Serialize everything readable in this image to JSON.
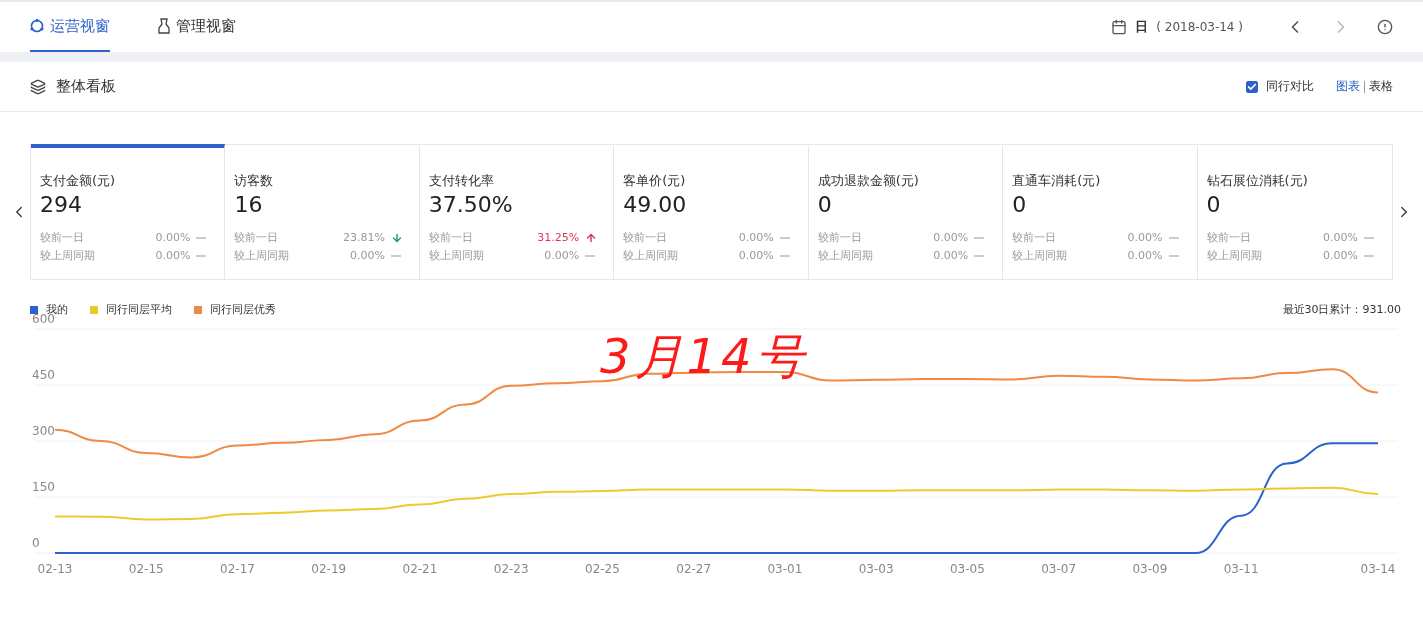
{
  "tabs": [
    {
      "label": "运营视窗",
      "selected": true
    },
    {
      "label": "管理视窗",
      "selected": false
    }
  ],
  "date": {
    "label": "日",
    "value": "( 2018-03-14 )"
  },
  "panel": {
    "title": "整体看板",
    "compare": {
      "label": "同行对比",
      "checked": true
    },
    "views": [
      {
        "label": "图表",
        "selected": true
      },
      {
        "label": "表格",
        "selected": false
      }
    ]
  },
  "metrics": [
    {
      "title": "支付金额(元)",
      "value": "294",
      "selected": true,
      "comparisons": [
        {
          "label": "较前一日",
          "value": "0.00%",
          "kind": "flat"
        },
        {
          "label": "较上周同期",
          "value": "0.00%",
          "kind": "flat"
        }
      ]
    },
    {
      "title": "访客数",
      "value": "16",
      "selected": false,
      "comparisons": [
        {
          "label": "较前一日",
          "value": "23.81%",
          "kind": "down"
        },
        {
          "label": "较上周同期",
          "value": "0.00%",
          "kind": "flat"
        }
      ]
    },
    {
      "title": "支付转化率",
      "value": "37.50%",
      "selected": false,
      "comparisons": [
        {
          "label": "较前一日",
          "value": "31.25%",
          "kind": "up"
        },
        {
          "label": "较上周同期",
          "value": "0.00%",
          "kind": "flat"
        }
      ]
    },
    {
      "title": "客单价(元)",
      "value": "49.00",
      "selected": false,
      "comparisons": [
        {
          "label": "较前一日",
          "value": "0.00%",
          "kind": "flat"
        },
        {
          "label": "较上周同期",
          "value": "0.00%",
          "kind": "flat"
        }
      ]
    },
    {
      "title": "成功退款金额(元)",
      "value": "0",
      "selected": false,
      "comparisons": [
        {
          "label": "较前一日",
          "value": "0.00%",
          "kind": "flat"
        },
        {
          "label": "较上周同期",
          "value": "0.00%",
          "kind": "flat"
        }
      ]
    },
    {
      "title": "直通车消耗(元)",
      "value": "0",
      "selected": false,
      "comparisons": [
        {
          "label": "较前一日",
          "value": "0.00%",
          "kind": "flat"
        },
        {
          "label": "较上周同期",
          "value": "0.00%",
          "kind": "flat"
        }
      ]
    },
    {
      "title": "钻石展位消耗(元)",
      "value": "0",
      "selected": false,
      "comparisons": [
        {
          "label": "较前一日",
          "value": "0.00%",
          "kind": "flat"
        },
        {
          "label": "较上周同期",
          "value": "0.00%",
          "kind": "flat"
        }
      ]
    }
  ],
  "total": "最近30日累计：931.00",
  "chart_data": {
    "type": "line",
    "categories": [
      "02-13",
      null,
      "02-15",
      null,
      "02-17",
      null,
      "02-19",
      null,
      "02-21",
      null,
      "02-23",
      null,
      "02-25",
      null,
      "02-27",
      null,
      "03-01",
      null,
      "03-03",
      null,
      "03-05",
      null,
      "03-07",
      null,
      "03-09",
      null,
      "03-11",
      null,
      null,
      "03-14"
    ],
    "series": [
      {
        "name": "我的",
        "color": "#2c62c9",
        "values": [
          0,
          0,
          0,
          0,
          0,
          0,
          0,
          0,
          0,
          0,
          0,
          0,
          0,
          0,
          0,
          0,
          0,
          0,
          0,
          0,
          0,
          0,
          0,
          0,
          0,
          0,
          100,
          240,
          294,
          294
        ]
      },
      {
        "name": "同行同层平均",
        "color": "#ebcb2c",
        "values": [
          98,
          97,
          90,
          91,
          104,
          108,
          114,
          118,
          130,
          145,
          158,
          164,
          166,
          170,
          170,
          170,
          170,
          167,
          167,
          168,
          168,
          168,
          170,
          170,
          168,
          167,
          170,
          173,
          175,
          158
        ]
      },
      {
        "name": "同行同层优秀",
        "color": "#ee8a45",
        "values": [
          330,
          300,
          268,
          256,
          288,
          295,
          303,
          318,
          355,
          398,
          448,
          455,
          460,
          480,
          483,
          485,
          485,
          462,
          464,
          466,
          466,
          465,
          475,
          472,
          465,
          462,
          468,
          482,
          492,
          430
        ]
      }
    ],
    "ylim": [
      0,
      600
    ],
    "yticks": [
      0,
      150,
      300,
      450,
      600
    ],
    "grid": true
  },
  "annotation": {
    "text": "3月14号",
    "color": "#ff1a1a"
  }
}
